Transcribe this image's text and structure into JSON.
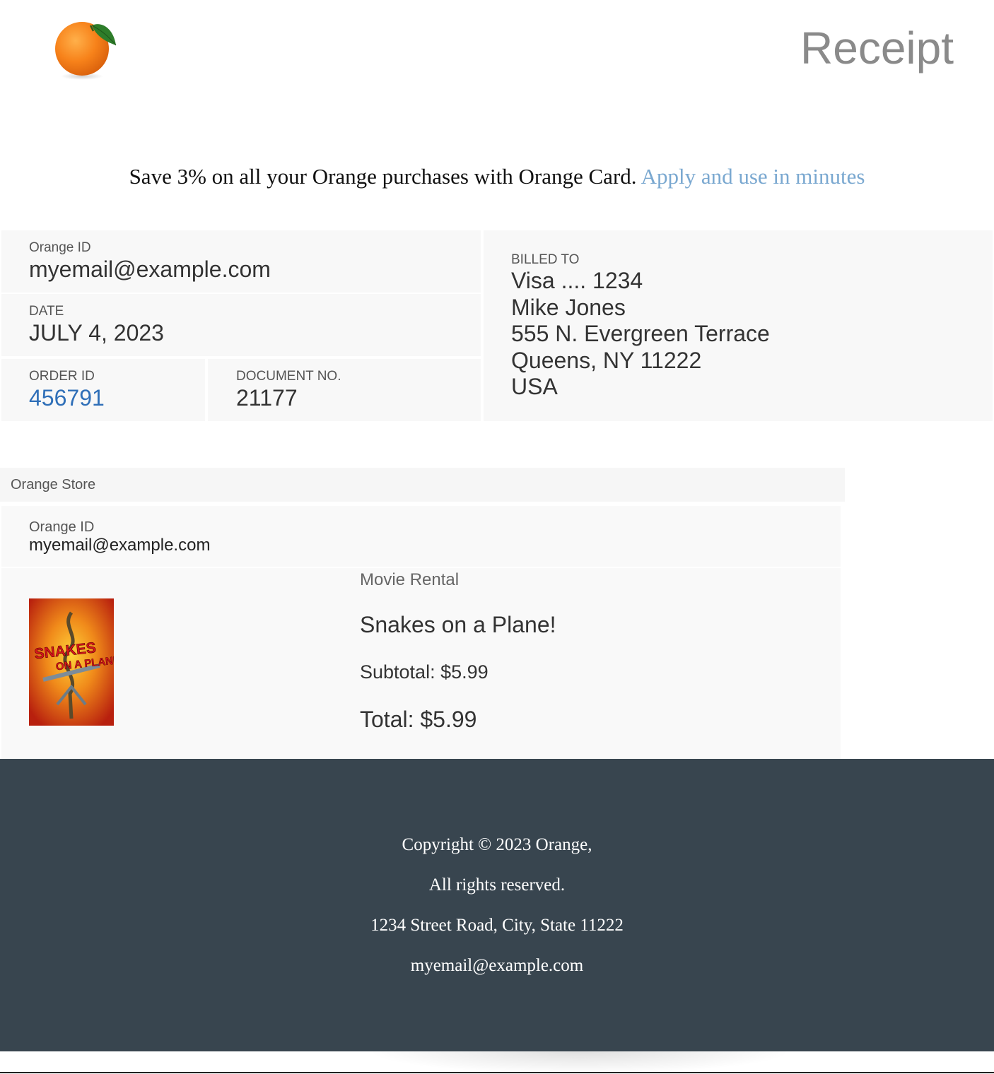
{
  "header": {
    "logo_icon": "orange-fruit-icon",
    "title": "Receipt"
  },
  "promo": {
    "text": "Save 3% on all your Orange purchases with Orange Card.",
    "link_text": "Apply and use in minutes"
  },
  "account": {
    "orange_id_label": "Orange ID",
    "orange_id_value": "myemail@example.com",
    "date_label": "DATE",
    "date_value": "JULY 4, 2023",
    "order_id_label": "ORDER ID",
    "order_id_value": "456791",
    "document_no_label": "DOCUMENT NO.",
    "document_no_value": "21177"
  },
  "billing": {
    "label": "BILLED TO",
    "lines": [
      "Visa .... 1234",
      "Mike Jones",
      "555 N. Evergreen Terrace",
      "Queens, NY 11222",
      "USA"
    ]
  },
  "store": {
    "name": "Orange Store",
    "orange_id_label": "Orange ID",
    "orange_id_value": "myemail@example.com",
    "item": {
      "type": "Movie Rental",
      "title": "Snakes on a Plane!",
      "poster_text_line1": "SNAKES",
      "poster_text_line2": "ON A PLANE",
      "subtotal": "Subtotal: $5.99",
      "total": "Total: $5.99"
    }
  },
  "footer": {
    "copyright": "Copyright © 2023 Orange,",
    "rights": "All rights reserved.",
    "address": "1234 Street Road, City, State 11222",
    "email": "myemail@example.com"
  },
  "colors": {
    "title_gray": "#8a8a8a",
    "link_blue": "#7aa8d0",
    "order_link_blue": "#2f6fb8",
    "footer_bg": "#38454f",
    "panel_bg": "#f8f8f8"
  }
}
